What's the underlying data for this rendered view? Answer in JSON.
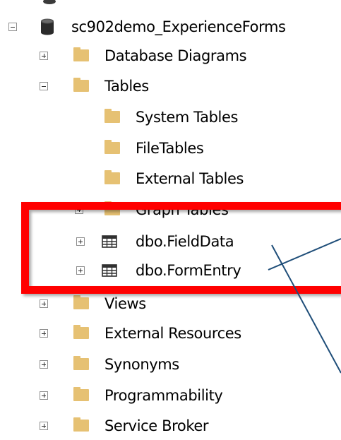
{
  "tree": {
    "database": {
      "label": "sc902demo_ExperienceForms",
      "expanded": true
    },
    "nodes": [
      {
        "label": "Database Diagrams",
        "expander": "collapsed",
        "icon": "folder-icon"
      },
      {
        "label": "Tables",
        "expander": "expanded",
        "icon": "folder-icon"
      },
      {
        "label": "System Tables",
        "expander": "none",
        "icon": "folder-icon"
      },
      {
        "label": "FileTables",
        "expander": "none",
        "icon": "folder-icon"
      },
      {
        "label": "External Tables",
        "expander": "none",
        "icon": "folder-icon"
      },
      {
        "label": "Graph Tables",
        "expander": "collapsed",
        "icon": "folder-icon"
      },
      {
        "label": "dbo.FieldData",
        "expander": "collapsed",
        "icon": "table-icon"
      },
      {
        "label": "dbo.FormEntry",
        "expander": "collapsed",
        "icon": "table-icon"
      },
      {
        "label": "Views",
        "expander": "collapsed",
        "icon": "folder-icon"
      },
      {
        "label": "External Resources",
        "expander": "collapsed",
        "icon": "folder-icon"
      },
      {
        "label": "Synonyms",
        "expander": "collapsed",
        "icon": "folder-icon"
      },
      {
        "label": "Programmability",
        "expander": "collapsed",
        "icon": "folder-icon"
      },
      {
        "label": "Service Broker",
        "expander": "collapsed",
        "icon": "folder-icon"
      }
    ]
  },
  "colors": {
    "highlight": "#ff0000",
    "connector": "#1f4e79",
    "folder": "#e6c173",
    "text": "#000000"
  }
}
